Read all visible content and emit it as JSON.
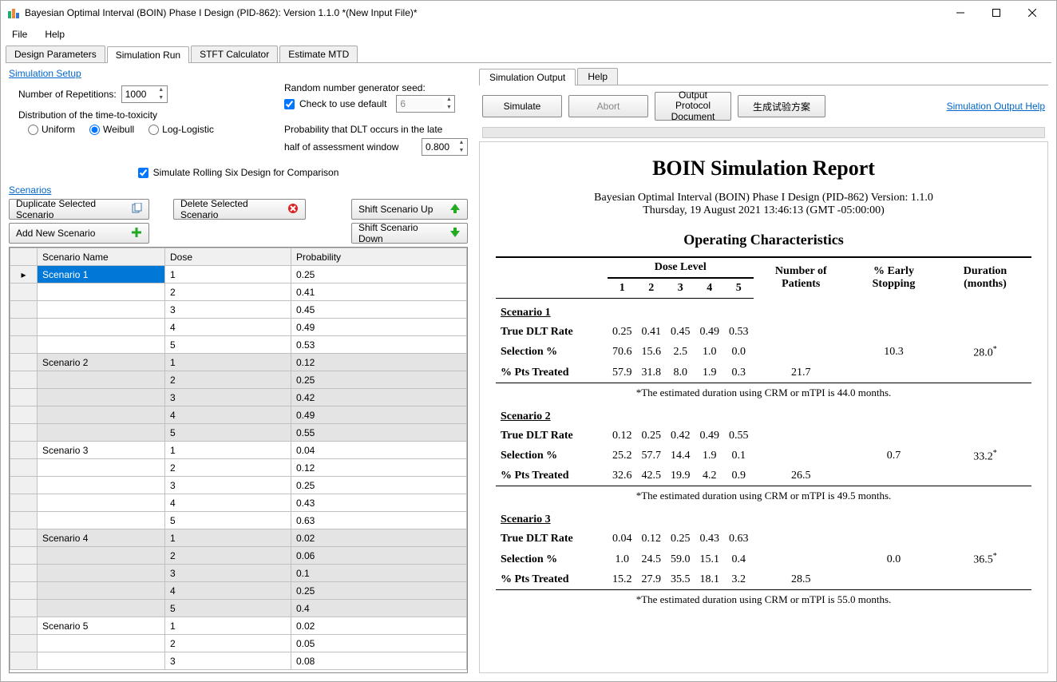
{
  "window": {
    "title": "Bayesian Optimal Interval (BOIN) Phase I Design (PID-862): Version 1.1.0    *(New Input File)*"
  },
  "menu": {
    "file": "File",
    "help": "Help"
  },
  "tabs": {
    "design": "Design Parameters",
    "sim": "Simulation Run",
    "stft": "STFT Calculator",
    "mtd": "Estimate MTD"
  },
  "setup": {
    "group": "Simulation Setup",
    "reps_label": "Number of Repetitions:",
    "reps_value": "1000",
    "seed_label": "Random number generator seed:",
    "seed_cb": "Check to use default",
    "seed_value": "6",
    "dist_label": "Distribution of the time-to-toxicity",
    "dist_uniform": "Uniform",
    "dist_weibull": "Weibull",
    "dist_loglog": "Log-Logistic",
    "prob_late_label1": "Probability that DLT occurs in the late",
    "prob_late_label2": "half of assessment window",
    "prob_late_value": "0.800",
    "rolling_cb": "Simulate Rolling Six Design for Comparison"
  },
  "scenarios": {
    "group": "Scenarios",
    "btn_dup": "Duplicate Selected Scenario",
    "btn_del": "Delete Selected Scenario",
    "btn_add": "Add New Scenario",
    "btn_up": "Shift Scenario Up",
    "btn_down": "Shift Scenario Down",
    "col_name": "Scenario Name",
    "col_dose": "Dose",
    "col_prob": "Probability",
    "rows": [
      {
        "name": "Scenario 1",
        "dose": "1",
        "prob": "0.25",
        "sel": true,
        "shade": false,
        "ptr": true
      },
      {
        "name": "",
        "dose": "2",
        "prob": "0.41",
        "shade": false
      },
      {
        "name": "",
        "dose": "3",
        "prob": "0.45",
        "shade": false
      },
      {
        "name": "",
        "dose": "4",
        "prob": "0.49",
        "shade": false
      },
      {
        "name": "",
        "dose": "5",
        "prob": "0.53",
        "shade": false
      },
      {
        "name": "Scenario 2",
        "dose": "1",
        "prob": "0.12",
        "shade": true
      },
      {
        "name": "",
        "dose": "2",
        "prob": "0.25",
        "shade": true
      },
      {
        "name": "",
        "dose": "3",
        "prob": "0.42",
        "shade": true
      },
      {
        "name": "",
        "dose": "4",
        "prob": "0.49",
        "shade": true
      },
      {
        "name": "",
        "dose": "5",
        "prob": "0.55",
        "shade": true
      },
      {
        "name": "Scenario 3",
        "dose": "1",
        "prob": "0.04",
        "shade": false
      },
      {
        "name": "",
        "dose": "2",
        "prob": "0.12",
        "shade": false
      },
      {
        "name": "",
        "dose": "3",
        "prob": "0.25",
        "shade": false
      },
      {
        "name": "",
        "dose": "4",
        "prob": "0.43",
        "shade": false
      },
      {
        "name": "",
        "dose": "5",
        "prob": "0.63",
        "shade": false
      },
      {
        "name": "Scenario 4",
        "dose": "1",
        "prob": "0.02",
        "shade": true
      },
      {
        "name": "",
        "dose": "2",
        "prob": "0.06",
        "shade": true
      },
      {
        "name": "",
        "dose": "3",
        "prob": "0.1",
        "shade": true
      },
      {
        "name": "",
        "dose": "4",
        "prob": "0.25",
        "shade": true
      },
      {
        "name": "",
        "dose": "5",
        "prob": "0.4",
        "shade": true
      },
      {
        "name": "Scenario 5",
        "dose": "1",
        "prob": "0.02",
        "shade": false
      },
      {
        "name": "",
        "dose": "2",
        "prob": "0.05",
        "shade": false
      },
      {
        "name": "",
        "dose": "3",
        "prob": "0.08",
        "shade": false
      }
    ]
  },
  "output": {
    "tab_sim": "Simulation Output",
    "tab_help": "Help",
    "btn_simulate": "Simulate",
    "btn_abort": "Abort",
    "btn_doc": "Output Protocol Document",
    "btn_cn": "生成试验方案",
    "link_help": "Simulation Output Help"
  },
  "report": {
    "title": "BOIN Simulation Report",
    "sub1": "Bayesian Optimal Interval (BOIN) Phase I Design (PID-862) Version: 1.1.0",
    "sub2": "Thursday, 19 August 2021 13:46:13 (GMT -05:00:00)",
    "oc_title": "Operating Characteristics",
    "hdr_dose": "Dose Level",
    "hdr_npat": "Number of Patients",
    "hdr_early": "% Early Stopping",
    "hdr_dur": "Duration (months)",
    "dose_cols": [
      "1",
      "2",
      "3",
      "4",
      "5"
    ],
    "scenarios": [
      {
        "name": "Scenario 1",
        "true_dlt": [
          "0.25",
          "0.41",
          "0.45",
          "0.49",
          "0.53"
        ],
        "sel": [
          "70.6",
          "15.6",
          "2.5",
          "1.0",
          "0.0"
        ],
        "pts": [
          "57.9",
          "31.8",
          "8.0",
          "1.9",
          "0.3"
        ],
        "npat": "21.7",
        "early": "10.3",
        "dur": "28.0",
        "foot": "*The estimated duration using CRM or mTPI is 44.0 months."
      },
      {
        "name": "Scenario 2",
        "true_dlt": [
          "0.12",
          "0.25",
          "0.42",
          "0.49",
          "0.55"
        ],
        "sel": [
          "25.2",
          "57.7",
          "14.4",
          "1.9",
          "0.1"
        ],
        "pts": [
          "32.6",
          "42.5",
          "19.9",
          "4.2",
          "0.9"
        ],
        "npat": "26.5",
        "early": "0.7",
        "dur": "33.2",
        "foot": "*The estimated duration using CRM or mTPI is 49.5 months."
      },
      {
        "name": "Scenario 3",
        "true_dlt": [
          "0.04",
          "0.12",
          "0.25",
          "0.43",
          "0.63"
        ],
        "sel": [
          "1.0",
          "24.5",
          "59.0",
          "15.1",
          "0.4"
        ],
        "pts": [
          "15.2",
          "27.9",
          "35.5",
          "18.1",
          "3.2"
        ],
        "npat": "28.5",
        "early": "0.0",
        "dur": "36.5",
        "foot": "*The estimated duration using CRM or mTPI is 55.0 months."
      }
    ],
    "row_true": "True DLT Rate",
    "row_sel": "Selection %",
    "row_pts": "% Pts Treated"
  },
  "chart_data": {
    "type": "table",
    "title": "Operating Characteristics",
    "dose_levels": [
      1,
      2,
      3,
      4,
      5
    ],
    "scenarios": [
      {
        "name": "Scenario 1",
        "true_dlt_rate": [
          0.25,
          0.41,
          0.45,
          0.49,
          0.53
        ],
        "selection_pct": [
          70.6,
          15.6,
          2.5,
          1.0,
          0.0
        ],
        "pts_treated_pct": [
          57.9,
          31.8,
          8.0,
          1.9,
          0.3
        ],
        "num_patients": 21.7,
        "early_stopping_pct": 10.3,
        "duration_months": 28.0,
        "crm_mtpi_duration_months": 44.0
      },
      {
        "name": "Scenario 2",
        "true_dlt_rate": [
          0.12,
          0.25,
          0.42,
          0.49,
          0.55
        ],
        "selection_pct": [
          25.2,
          57.7,
          14.4,
          1.9,
          0.1
        ],
        "pts_treated_pct": [
          32.6,
          42.5,
          19.9,
          4.2,
          0.9
        ],
        "num_patients": 26.5,
        "early_stopping_pct": 0.7,
        "duration_months": 33.2,
        "crm_mtpi_duration_months": 49.5
      },
      {
        "name": "Scenario 3",
        "true_dlt_rate": [
          0.04,
          0.12,
          0.25,
          0.43,
          0.63
        ],
        "selection_pct": [
          1.0,
          24.5,
          59.0,
          15.1,
          0.4
        ],
        "pts_treated_pct": [
          15.2,
          27.9,
          35.5,
          18.1,
          3.2
        ],
        "num_patients": 28.5,
        "early_stopping_pct": 0.0,
        "duration_months": 36.5,
        "crm_mtpi_duration_months": 55.0
      }
    ]
  }
}
